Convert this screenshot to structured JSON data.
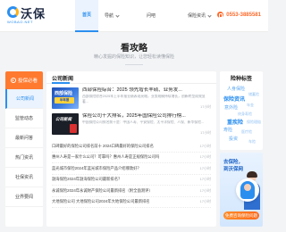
{
  "header": {
    "logo_text": "沃保",
    "logo_sub": "WOBAO.NET",
    "nav": [
      {
        "label": "首页",
        "active": true,
        "dropdown": false
      },
      {
        "label": "导航",
        "active": false,
        "dropdown": true
      },
      {
        "label": "问吧",
        "active": false,
        "dropdown": false
      },
      {
        "label": "保险资讯",
        "active": false,
        "dropdown": true
      }
    ],
    "phone": "0553-3885581"
  },
  "hero": {
    "title": "看攻略",
    "subtitle": "精心发掘的保险知识，让您轻松读懂保险"
  },
  "sidebar": {
    "header": "投保必看",
    "items": [
      "公司新闻",
      "监管动态",
      "最新问答",
      "热门资讯",
      "社保资讯",
      "业界要闻"
    ],
    "active_index": 0
  },
  "news": {
    "title": "公司新闻",
    "featured": [
      {
        "thumb_title": "西部保险",
        "thumb_badge": "半年报",
        "title": "西部保险综合：2025 领先增长丰硕、业务发...",
        "desc": "西部保险综合2025年上半年报业绩表现亮眼，业务规模持续增长，创新转型成效显著...",
        "date": "17小时"
      },
      {
        "thumb_title": "公司新闻",
        "thumb_badge": "",
        "title": "保险公司十大排名，2025年国保险公司排行榜...",
        "desc": "中国保险公司排名前十是：中国人寿、平安保险、太平洋保险、人保、新华保险...",
        "date": "17小时"
      }
    ],
    "rows": [
      {
        "text": "口碑最好的保险公司排名前十 2024口碑最好的保险公司排名",
        "date": "17小时"
      },
      {
        "text": "惠州人寿是一家什么公司？可靠吗？惠州人寿是正规保险公司吗",
        "date": "17小时"
      },
      {
        "text": "蓝光城市保险2024年蓝光城市保险产品介绍哪款好？",
        "date": "17小时"
      },
      {
        "text": "渤海保险2024年渤海保险公司最新排名？",
        "date": "17小时"
      },
      {
        "text": "永诚保险2024年永诚财产保险公司最新排名（附全面测评）",
        "date": "17小时"
      },
      {
        "text": "大地保险公司 大地保险公司2024年大地保险公司最新排名",
        "date": "17小时"
      }
    ]
  },
  "tags_panel": {
    "title": "险种标签",
    "tags": [
      "人身保险",
      "储蓄险",
      "保险资讯",
      "年金",
      "意外险",
      "终身寿险",
      "重疾险",
      "保险理赔",
      "寿险",
      "医疗险",
      "投资",
      "车险"
    ]
  },
  "promo": {
    "line1": "去保险，",
    "line2": "到沃保网",
    "button": "免费咨询保险问题"
  },
  "colors": {
    "accent": "#2b8ff0",
    "orange": "#ff7a2f"
  }
}
